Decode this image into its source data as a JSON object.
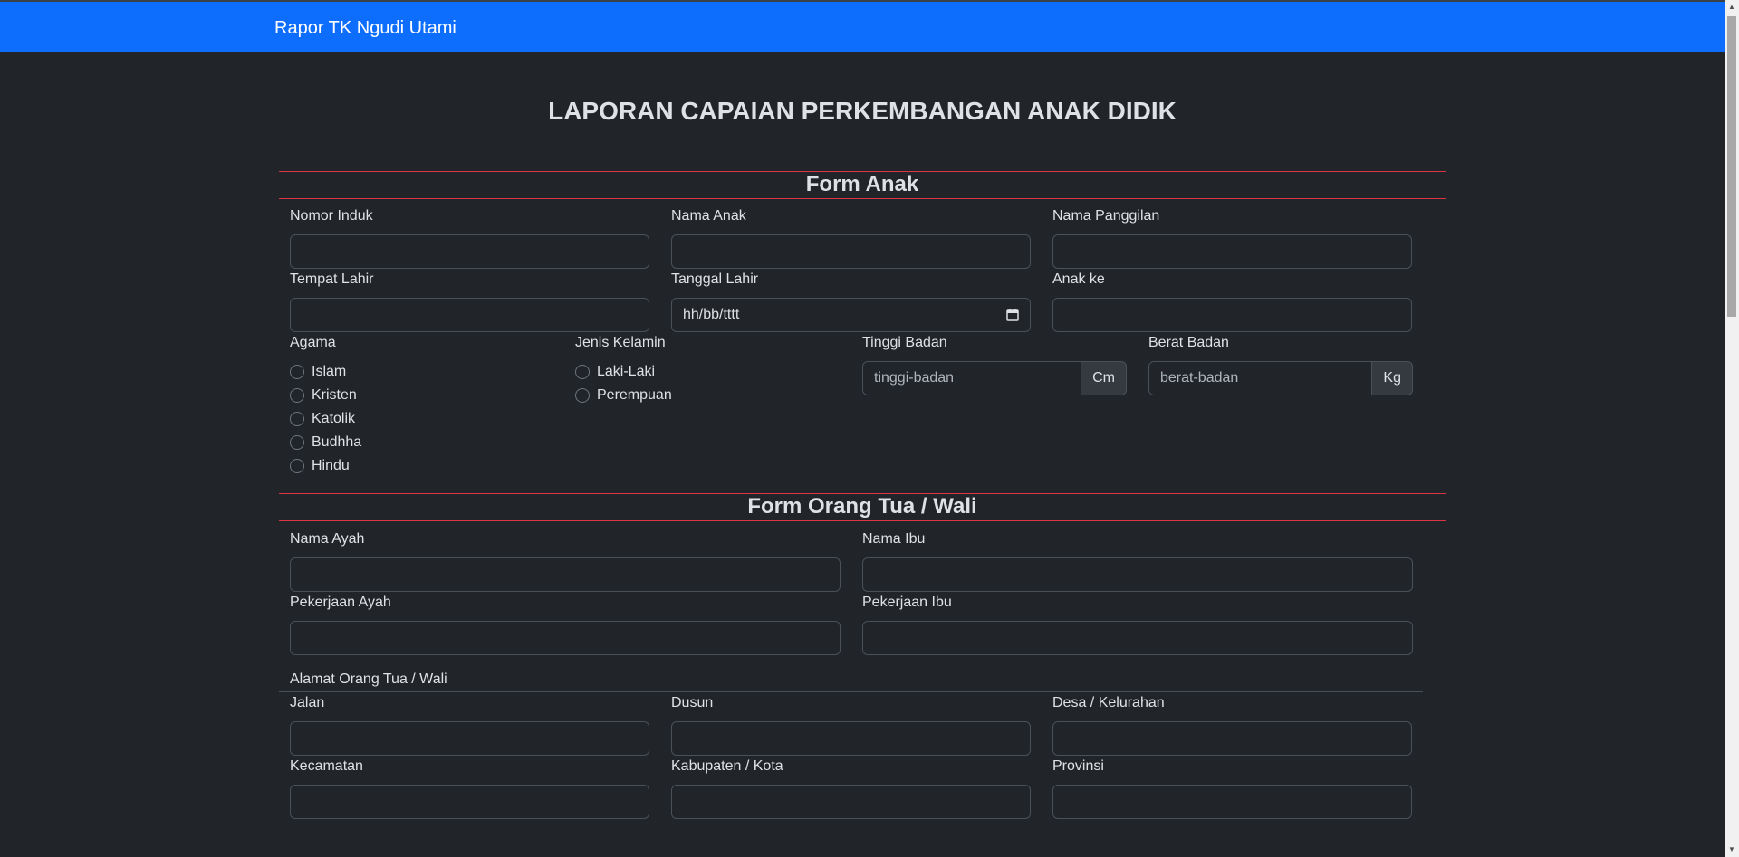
{
  "navbar": {
    "brand": "Rapor TK Ngudi Utami"
  },
  "page_title": "LAPORAN CAPAIAN PERKEMBANGAN ANAK DIDIK",
  "form_anak": {
    "header": "Form Anak",
    "nomor_induk": {
      "label": "Nomor Induk",
      "value": ""
    },
    "nama_anak": {
      "label": "Nama Anak",
      "value": ""
    },
    "nama_panggilan": {
      "label": "Nama Panggilan",
      "value": ""
    },
    "tempat_lahir": {
      "label": "Tempat Lahir",
      "value": ""
    },
    "tanggal_lahir": {
      "label": "Tanggal Lahir",
      "value": "hh/bb/tttt"
    },
    "anak_ke": {
      "label": "Anak ke",
      "value": ""
    },
    "agama": {
      "label": "Agama",
      "options": [
        "Islam",
        "Kristen",
        "Katolik",
        "Budhha",
        "Hindu"
      ]
    },
    "jenis_kelamin": {
      "label": "Jenis Kelamin",
      "options": [
        "Laki-Laki",
        "Perempuan"
      ]
    },
    "tinggi_badan": {
      "label": "Tinggi Badan",
      "placeholder": "tinggi-badan",
      "unit": "Cm"
    },
    "berat_badan": {
      "label": "Berat Badan",
      "placeholder": "berat-badan",
      "unit": "Kg"
    }
  },
  "form_ortu": {
    "header": "Form Orang Tua / Wali",
    "nama_ayah": {
      "label": "Nama Ayah",
      "value": ""
    },
    "nama_ibu": {
      "label": "Nama Ibu",
      "value": ""
    },
    "pekerjaan_ayah": {
      "label": "Pekerjaan Ayah",
      "value": ""
    },
    "pekerjaan_ibu": {
      "label": "Pekerjaan Ibu",
      "value": ""
    },
    "alamat_label": "Alamat Orang Tua / Wali",
    "jalan": {
      "label": "Jalan",
      "value": ""
    },
    "dusun": {
      "label": "Dusun",
      "value": ""
    },
    "desa": {
      "label": "Desa / Kelurahan",
      "value": ""
    },
    "kecamatan": {
      "label": "Kecamatan",
      "value": ""
    },
    "kabupaten": {
      "label": "Kabupaten / Kota",
      "value": ""
    },
    "provinsi": {
      "label": "Provinsi",
      "value": ""
    }
  }
}
